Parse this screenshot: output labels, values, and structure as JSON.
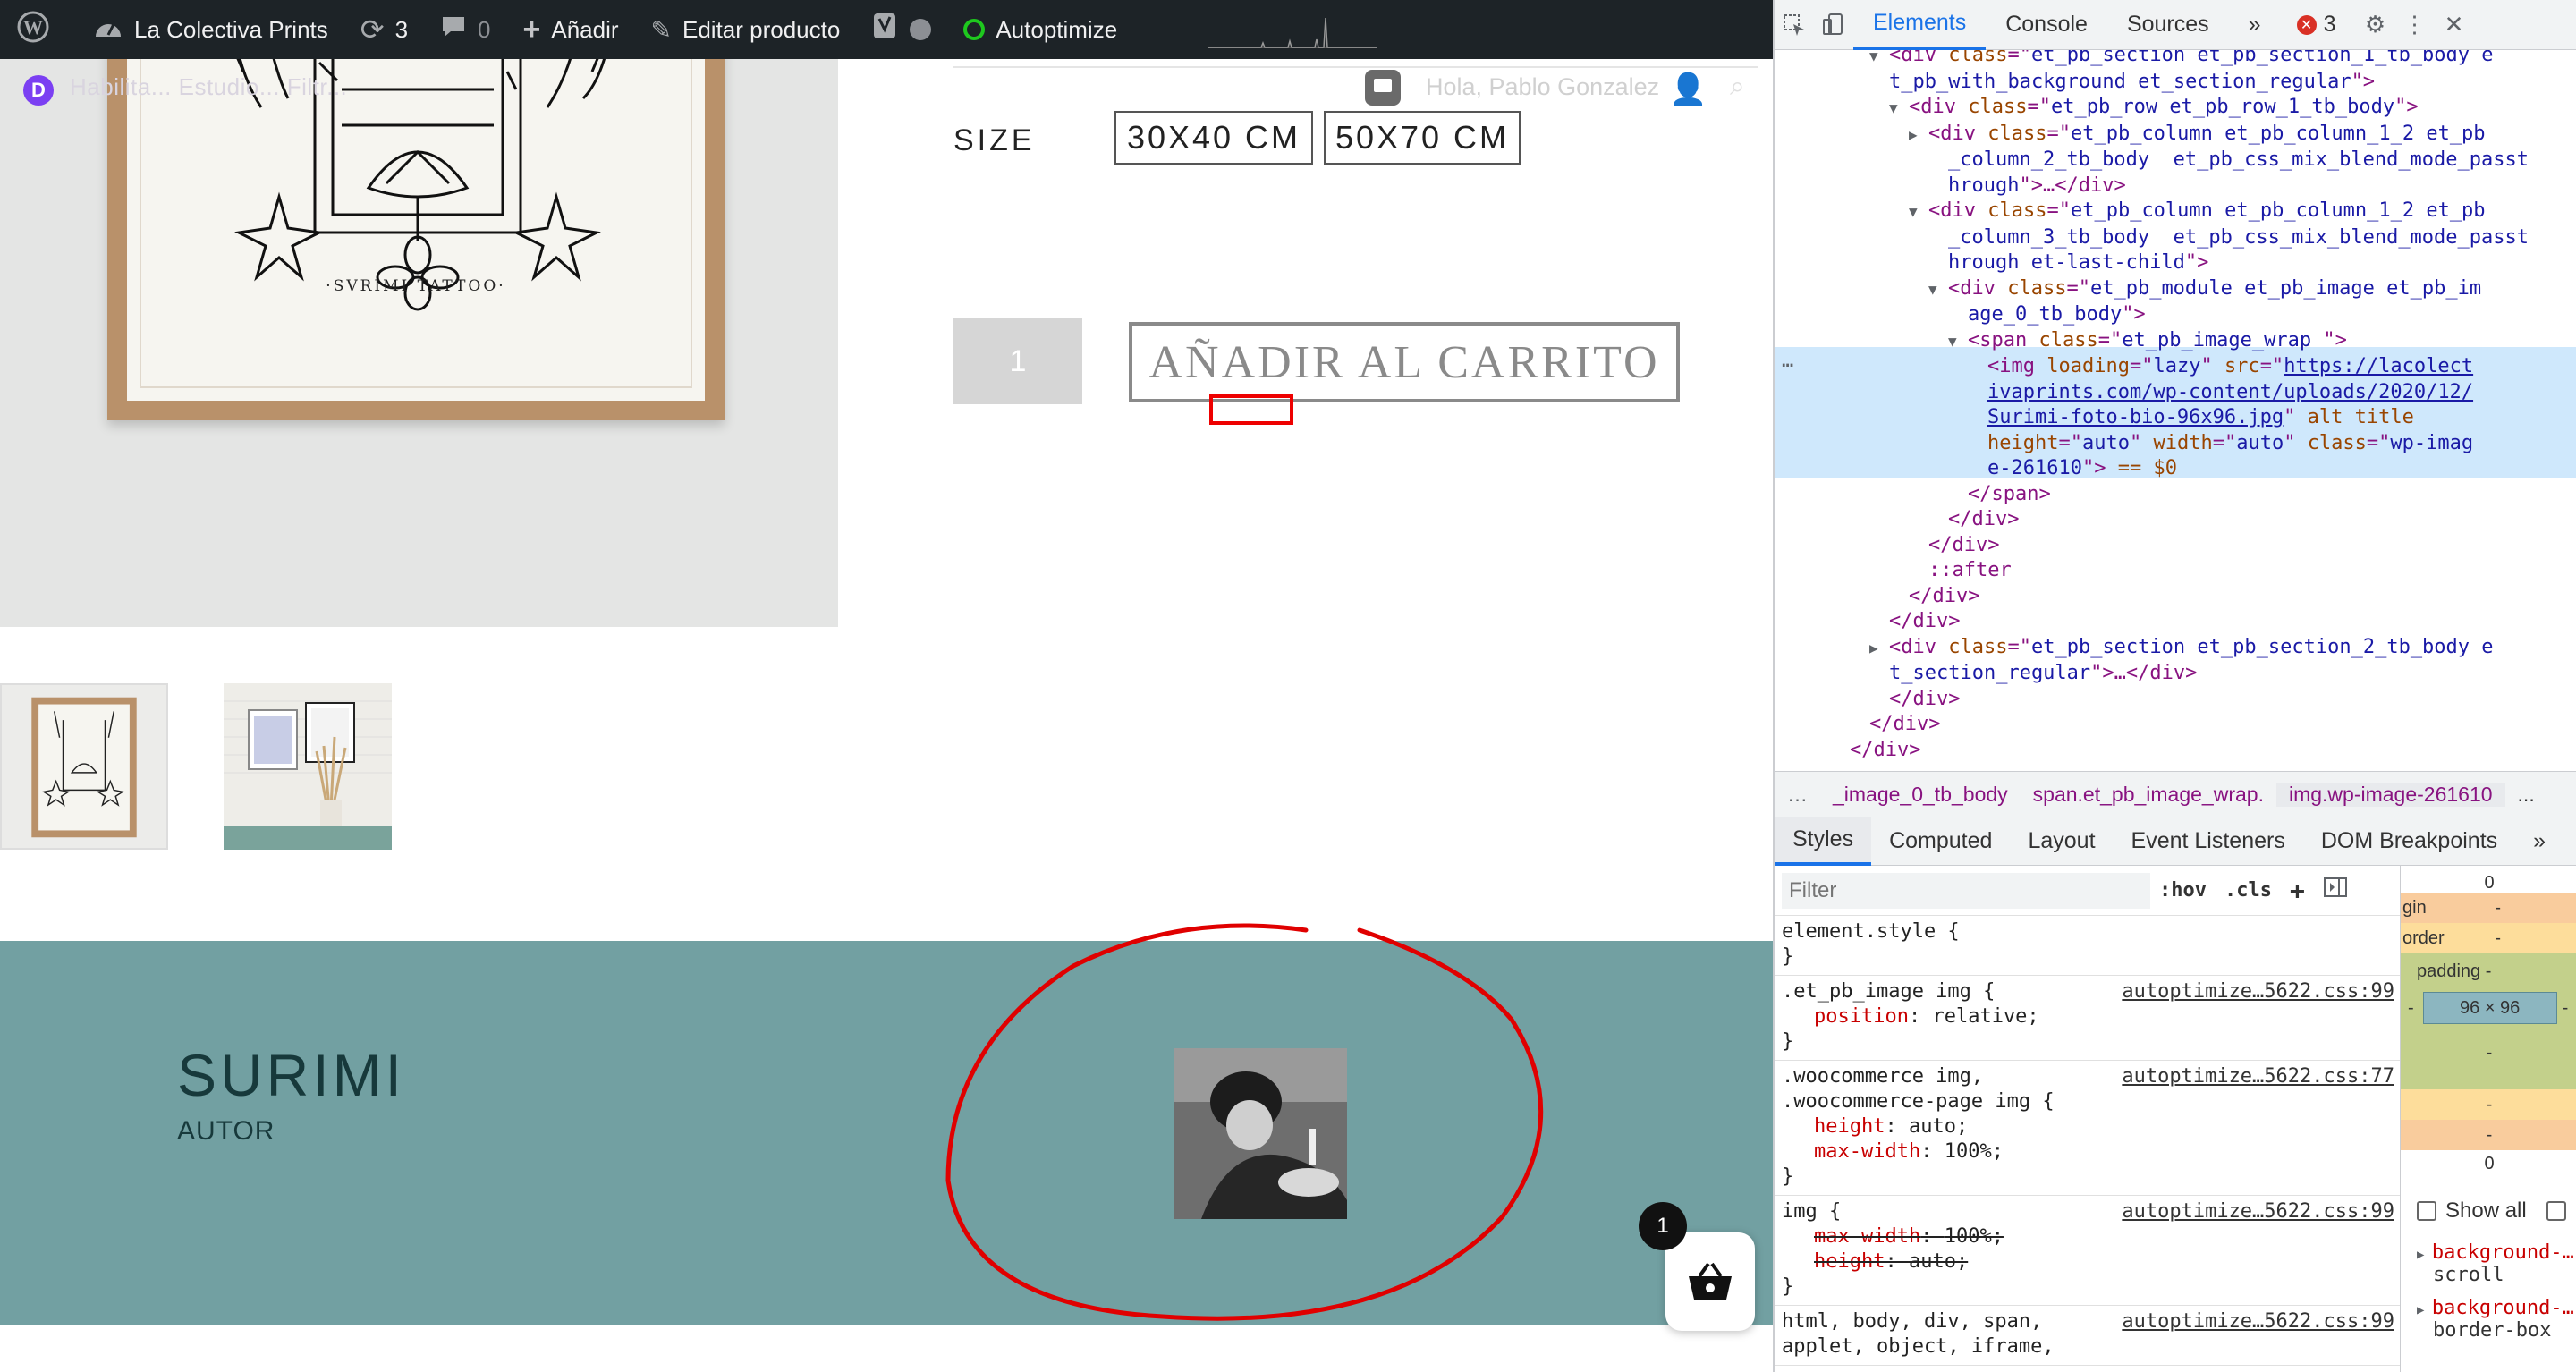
{
  "adminbar": {
    "site_name": "La Colectiva Prints",
    "updates_count": "3",
    "comments_count": "0",
    "add_new_label": "Añadir",
    "edit_product_label": "Editar producto",
    "autoptimize_label": "Autoptimize"
  },
  "divibar": {
    "text": "Habilita... Estudio... Filtr...",
    "greeting": "Hola, Pablo Gonzalez"
  },
  "product": {
    "art_caption": "·SVRIMI TATTOO·",
    "size_label": "SIZE",
    "sizes": [
      "30X40 CM",
      "50X70 CM"
    ],
    "quantity": "1",
    "add_to_cart_label": "AÑADIR AL CARRITO"
  },
  "author": {
    "name": "SURIMI",
    "role": "AUTOR"
  },
  "cart": {
    "count": "1"
  },
  "colors": {
    "author_band": "#72a0a2",
    "admin_bar": "#1d2327",
    "annotation": "#e00000"
  },
  "devtools": {
    "tabs": [
      "Elements",
      "Console",
      "Sources"
    ],
    "active_tab": "Elements",
    "more_tabs": "»",
    "error_count": "3",
    "dom_lines": [
      {
        "indent": 4,
        "tri": "▼",
        "parts": [
          [
            "tg",
            "<div "
          ],
          [
            "an",
            "class"
          ],
          [
            "tg",
            "=\""
          ],
          [
            "av",
            "et_pb_section et_pb_section_1_tb_body e"
          ],
          [
            "tg",
            ""
          ]
        ]
      },
      {
        "indent": 4,
        "tri": "",
        "parts": [
          [
            "av",
            "t_pb_with_background et_section_regular"
          ],
          [
            "tg",
            "\">"
          ]
        ]
      },
      {
        "indent": 5,
        "tri": "▼",
        "parts": [
          [
            "tg",
            "<div "
          ],
          [
            "an",
            "class"
          ],
          [
            "tg",
            "=\""
          ],
          [
            "av",
            "et_pb_row et_pb_row_1_tb_body"
          ],
          [
            "tg",
            "\">"
          ]
        ]
      },
      {
        "indent": 6,
        "tri": "▶",
        "parts": [
          [
            "tg",
            "<div "
          ],
          [
            "an",
            "class"
          ],
          [
            "tg",
            "=\""
          ],
          [
            "av",
            "et_pb_column et_pb_column_1_2 et_pb"
          ]
        ]
      },
      {
        "indent": 7,
        "tri": "",
        "parts": [
          [
            "av",
            "_column_2_tb_body  et_pb_css_mix_blend_mode_passt"
          ]
        ]
      },
      {
        "indent": 7,
        "tri": "",
        "parts": [
          [
            "av",
            "hrough"
          ],
          [
            "tg",
            "\">…</div>"
          ]
        ]
      },
      {
        "indent": 6,
        "tri": "▼",
        "parts": [
          [
            "tg",
            "<div "
          ],
          [
            "an",
            "class"
          ],
          [
            "tg",
            "=\""
          ],
          [
            "av",
            "et_pb_column et_pb_column_1_2 et_pb"
          ]
        ]
      },
      {
        "indent": 7,
        "tri": "",
        "parts": [
          [
            "av",
            "_column_3_tb_body  et_pb_css_mix_blend_mode_passt"
          ]
        ]
      },
      {
        "indent": 7,
        "tri": "",
        "parts": [
          [
            "av",
            "hrough et-last-child"
          ],
          [
            "tg",
            "\">"
          ]
        ]
      },
      {
        "indent": 7,
        "tri": "▼",
        "parts": [
          [
            "tg",
            "<div "
          ],
          [
            "an",
            "class"
          ],
          [
            "tg",
            "=\""
          ],
          [
            "av",
            "et_pb_module et_pb_image et_pb_im"
          ]
        ]
      },
      {
        "indent": 8,
        "tri": "",
        "parts": [
          [
            "av",
            "age_0_tb_body"
          ],
          [
            "tg",
            "\">"
          ]
        ]
      },
      {
        "indent": 8,
        "tri": "▼",
        "parts": [
          [
            "tg",
            "<span "
          ],
          [
            "an",
            "class"
          ],
          [
            "tg",
            "=\""
          ],
          [
            "av",
            "et_pb_image_wrap "
          ],
          [
            "tg",
            "\">"
          ]
        ]
      },
      {
        "indent": 9,
        "tri": "",
        "parts": [
          [
            "tg",
            "<img "
          ],
          [
            "an",
            "loading"
          ],
          [
            "tg",
            "=\""
          ],
          [
            "av",
            "lazy"
          ],
          [
            "tg",
            "\" "
          ],
          [
            "an",
            "src"
          ],
          [
            "tg",
            "=\""
          ],
          [
            "lk",
            "https://lacolect"
          ]
        ]
      },
      {
        "indent": 9,
        "tri": "",
        "parts": [
          [
            "lk",
            "ivaprints.com/wp-content/uploads/2020/12/"
          ]
        ]
      },
      {
        "indent": 9,
        "tri": "",
        "parts": [
          [
            "lk",
            "Surimi-foto-bio-96x96.jpg"
          ],
          [
            "tg",
            "\" "
          ],
          [
            "an",
            "alt title"
          ]
        ]
      },
      {
        "indent": 9,
        "tri": "",
        "parts": [
          [
            "an",
            "height"
          ],
          [
            "tg",
            "=\""
          ],
          [
            "av",
            "auto"
          ],
          [
            "tg",
            "\" "
          ],
          [
            "an",
            "width"
          ],
          [
            "tg",
            "=\""
          ],
          [
            "av",
            "auto"
          ],
          [
            "tg",
            "\" "
          ],
          [
            "an",
            "class"
          ],
          [
            "tg",
            "=\""
          ],
          [
            "av",
            "wp-imag"
          ]
        ]
      },
      {
        "indent": 9,
        "tri": "",
        "parts": [
          [
            "av",
            "e-261610"
          ],
          [
            "tg",
            "\">"
          ],
          [
            "an",
            " == $0"
          ]
        ]
      },
      {
        "indent": 8,
        "tri": "",
        "parts": [
          [
            "tg",
            "</span>"
          ]
        ]
      },
      {
        "indent": 7,
        "tri": "",
        "parts": [
          [
            "tg",
            "</div>"
          ]
        ]
      },
      {
        "indent": 6,
        "tri": "",
        "parts": [
          [
            "tg",
            "</div>"
          ]
        ]
      },
      {
        "indent": 6,
        "tri": "",
        "parts": [
          [
            "tg",
            "::after"
          ]
        ]
      },
      {
        "indent": 5,
        "tri": "",
        "parts": [
          [
            "tg",
            "</div>"
          ]
        ]
      },
      {
        "indent": 4,
        "tri": "",
        "parts": [
          [
            "tg",
            "</div>"
          ]
        ]
      },
      {
        "indent": 4,
        "tri": "▶",
        "parts": [
          [
            "tg",
            "<div "
          ],
          [
            "an",
            "class"
          ],
          [
            "tg",
            "=\""
          ],
          [
            "av",
            "et_pb_section et_pb_section_2_tb_body e"
          ]
        ]
      },
      {
        "indent": 4,
        "tri": "",
        "parts": [
          [
            "av",
            "t_section_regular"
          ],
          [
            "tg",
            "\">…</div>"
          ]
        ]
      },
      {
        "indent": 4,
        "tri": "",
        "parts": [
          [
            "tg",
            "</div>"
          ]
        ]
      },
      {
        "indent": 3,
        "tri": "",
        "parts": [
          [
            "tg",
            "</div>"
          ]
        ]
      },
      {
        "indent": 2,
        "tri": "",
        "parts": [
          [
            "tg",
            "</div>"
          ]
        ]
      }
    ],
    "breadcrumbs": [
      "…",
      "_image_0_tb_body",
      "span.et_pb_image_wrap.",
      "img.wp-image-261610",
      "..."
    ],
    "sub_tabs": [
      "Styles",
      "Computed",
      "Layout",
      "Event Listeners",
      "DOM Breakpoints",
      "»"
    ],
    "active_sub_tab": "Styles",
    "filter_placeholder": "Filter",
    "hov_label": ":hov",
    "cls_label": ".cls",
    "rules": [
      {
        "selector": "element.style {",
        "source": "",
        "props": [],
        "close": "}"
      },
      {
        "selector": ".et_pb_image img {",
        "source": "autoptimize…5622.css:99",
        "props": [
          {
            "name": "position",
            "value": "relative;",
            "struck": false
          }
        ],
        "close": "}"
      },
      {
        "selector": ".woocommerce img,",
        "selector2": ".woocommerce-page img {",
        "source": "autoptimize…5622.css:77",
        "props": [
          {
            "name": "height",
            "value": "auto;",
            "struck": false
          },
          {
            "name": "max-width",
            "value": "100%;",
            "struck": false
          }
        ],
        "close": "}"
      },
      {
        "selector": "img {",
        "source": "autoptimize…5622.css:99",
        "props": [
          {
            "name": "max-width",
            "value": "100%;",
            "struck": true
          },
          {
            "name": "height",
            "value": "auto;",
            "struck": true
          }
        ],
        "close": "}"
      },
      {
        "selector": "html, body, div, span,",
        "selector2": "applet, object, iframe,",
        "source": "autoptimize…5622.css:99",
        "props": [],
        "close": ""
      }
    ],
    "box_model": {
      "top_value": "0",
      "margin_label": "gin",
      "margin_value": "-",
      "border_label": "order",
      "border_value": "-",
      "padding_label": "padding -",
      "content_size": "96 × 96",
      "left_dash": "-",
      "right_dash": "-",
      "padding_bottom": "-",
      "border_bottom": "-",
      "margin_bottom": "-",
      "bottom_value": "0"
    },
    "show_all_label": "Show all",
    "computed_props": [
      {
        "name": "background-…",
        "value": "scroll"
      },
      {
        "name": "background-…",
        "value": "border-box"
      }
    ]
  }
}
